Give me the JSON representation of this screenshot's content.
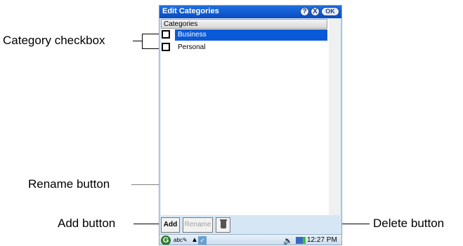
{
  "callouts": {
    "category_checkbox": "Category checkbox",
    "rename_button": "Rename button",
    "add_button": "Add button",
    "delete_button": "Delete button"
  },
  "window": {
    "title": "Edit Categories",
    "help_label": "?",
    "close_label": "X",
    "ok_label": "OK"
  },
  "list": {
    "header": "Categories",
    "items": [
      {
        "label": "Business",
        "selected": true,
        "checked": false
      },
      {
        "label": "Personal",
        "selected": false,
        "checked": false
      }
    ]
  },
  "toolbar": {
    "add_label": "Add",
    "rename_label": "Rename",
    "delete_icon": "trash-icon"
  },
  "taskbar": {
    "start_label": "G",
    "input_label": "abc",
    "clock": "12:27 PM"
  },
  "colors": {
    "title_bar": "#0a4cc0",
    "selection": "#0a5ad8",
    "device_bg": "#d6e6f4"
  }
}
